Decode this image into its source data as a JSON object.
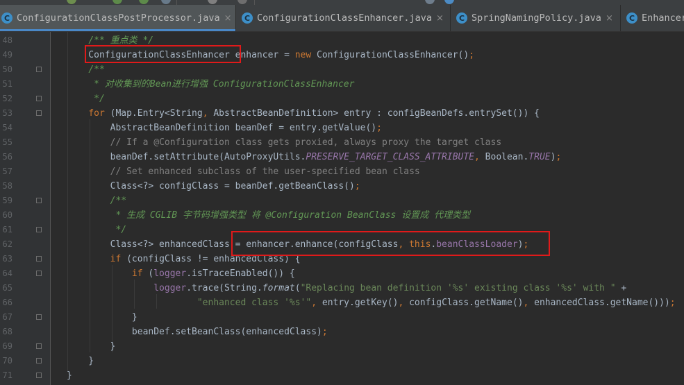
{
  "tabs": [
    {
      "label": "ConfigurationClassPostProcessor.java",
      "active": true,
      "icon": "class-icon"
    },
    {
      "label": "ConfigurationClassEnhancer.java",
      "active": false,
      "icon": "class-icon"
    },
    {
      "label": "SpringNamingPolicy.java",
      "active": false,
      "icon": "class-icon"
    },
    {
      "label": "Enhancer",
      "active": false,
      "icon": "class-icon"
    }
  ],
  "tab_icon_letter": "C",
  "tab_close_glyph": "×",
  "colors": {
    "keyword": "#cc7832",
    "comment": "#808080",
    "doc_comment": "#629755",
    "string": "#6a8759",
    "field": "#9876aa",
    "highlight_box": "#e01a1a",
    "tab_underline": "#4a88c7"
  },
  "lines": [
    {
      "n": "48",
      "seg": [
        [
          "    ",
          ""
        ],
        [
          "/** 重点类 */",
          "dc"
        ]
      ]
    },
    {
      "n": "49",
      "seg": [
        [
          "    ConfigurationClassEnhancer enhancer = ",
          ""
        ],
        [
          "new",
          "kw"
        ],
        [
          " ConfigurationClassEnhancer()",
          ""
        ],
        [
          ";",
          "kw"
        ]
      ]
    },
    {
      "n": "50",
      "seg": [
        [
          "    ",
          ""
        ],
        [
          "/**",
          "dc"
        ]
      ],
      "fold": true
    },
    {
      "n": "51",
      "seg": [
        [
          "     ",
          ""
        ],
        [
          "* 对收集到的Bean进行增强 ConfigurationClassEnhancer",
          "dc"
        ]
      ]
    },
    {
      "n": "52",
      "seg": [
        [
          "     ",
          ""
        ],
        [
          "*/",
          "dc"
        ]
      ],
      "fold": true
    },
    {
      "n": "53",
      "seg": [
        [
          "    ",
          ""
        ],
        [
          "for",
          "kw"
        ],
        [
          " (Map.Entry<String",
          ""
        ],
        [
          ",",
          "kw"
        ],
        [
          " AbstractBeanDefinition> entry : configBeanDefs.entrySet()) {",
          ""
        ]
      ],
      "fold": true
    },
    {
      "n": "54",
      "seg": [
        [
          "        AbstractBeanDefinition beanDef = entry.getValue()",
          ""
        ],
        [
          ";",
          "kw"
        ]
      ]
    },
    {
      "n": "55",
      "seg": [
        [
          "        ",
          ""
        ],
        [
          "// If a @Configuration class gets proxied, always proxy the target class",
          "cm"
        ]
      ]
    },
    {
      "n": "56",
      "seg": [
        [
          "        beanDef.setAttribute(AutoProxyUtils.",
          ""
        ],
        [
          "PRESERVE_TARGET_CLASS_ATTRIBUTE",
          "fd"
        ],
        [
          ",",
          "kw"
        ],
        [
          " Boolean.",
          ""
        ],
        [
          "TRUE",
          "fd"
        ],
        [
          ")",
          ""
        ],
        [
          ";",
          "kw"
        ]
      ]
    },
    {
      "n": "57",
      "seg": [
        [
          "        ",
          ""
        ],
        [
          "// Set enhanced subclass of the user-specified bean class",
          "cm"
        ]
      ]
    },
    {
      "n": "58",
      "seg": [
        [
          "        Class<?> configClass = beanDef.getBeanClass()",
          ""
        ],
        [
          ";",
          "kw"
        ]
      ]
    },
    {
      "n": "59",
      "seg": [
        [
          "        ",
          ""
        ],
        [
          "/**",
          "dc"
        ]
      ],
      "fold": true
    },
    {
      "n": "60",
      "seg": [
        [
          "         ",
          ""
        ],
        [
          "* 生成 CGLIB 字节码增强类型 将 @Configuration BeanClass 设置成 代理类型",
          "dc"
        ]
      ]
    },
    {
      "n": "61",
      "seg": [
        [
          "         ",
          ""
        ],
        [
          "*/",
          "dc"
        ]
      ],
      "fold": true
    },
    {
      "n": "62",
      "seg": [
        [
          "        Class<?> enhancedClass = enhancer.enhance(configClass",
          ""
        ],
        [
          ",",
          "kw"
        ],
        [
          " ",
          ""
        ],
        [
          "this",
          "kw"
        ],
        [
          ".",
          ""
        ],
        [
          "beanClassLoader",
          "fd2"
        ],
        [
          ")",
          ""
        ],
        [
          ";",
          "kw"
        ]
      ]
    },
    {
      "n": "63",
      "seg": [
        [
          "        ",
          ""
        ],
        [
          "if",
          "kw"
        ],
        [
          " (configClass != enhancedClass) {",
          ""
        ]
      ],
      "fold": true
    },
    {
      "n": "64",
      "seg": [
        [
          "            ",
          ""
        ],
        [
          "if",
          "kw"
        ],
        [
          " (",
          ""
        ],
        [
          "logger",
          "fd2"
        ],
        [
          ".isTraceEnabled()) {",
          ""
        ]
      ],
      "fold": true
    },
    {
      "n": "65",
      "seg": [
        [
          "                ",
          ""
        ],
        [
          "logger",
          "fd2"
        ],
        [
          ".trace(String.",
          ""
        ],
        [
          "format",
          "it"
        ],
        [
          "(",
          ""
        ],
        [
          "\"Replacing bean definition '%s' existing class '%s' with \"",
          "st"
        ],
        [
          " +",
          ""
        ]
      ]
    },
    {
      "n": "66",
      "seg": [
        [
          "                        ",
          ""
        ],
        [
          "\"enhanced class '%s'\"",
          "st"
        ],
        [
          ",",
          "kw"
        ],
        [
          " entry.getKey()",
          ""
        ],
        [
          ",",
          "kw"
        ],
        [
          " configClass.getName()",
          ""
        ],
        [
          ",",
          "kw"
        ],
        [
          " enhancedClass.getName()))",
          ""
        ],
        [
          ";",
          "kw"
        ]
      ]
    },
    {
      "n": "67",
      "seg": [
        [
          "            }",
          ""
        ]
      ],
      "fold": true
    },
    {
      "n": "68",
      "seg": [
        [
          "            beanDef.setBeanClass(enhancedClass)",
          ""
        ],
        [
          ";",
          "kw"
        ]
      ]
    },
    {
      "n": "69",
      "seg": [
        [
          "        }",
          ""
        ]
      ],
      "fold": true
    },
    {
      "n": "70",
      "seg": [
        [
          "    }",
          ""
        ]
      ],
      "fold": true
    },
    {
      "n": "71",
      "seg": [
        [
          "}",
          ""
        ]
      ],
      "fold": true
    }
  ]
}
